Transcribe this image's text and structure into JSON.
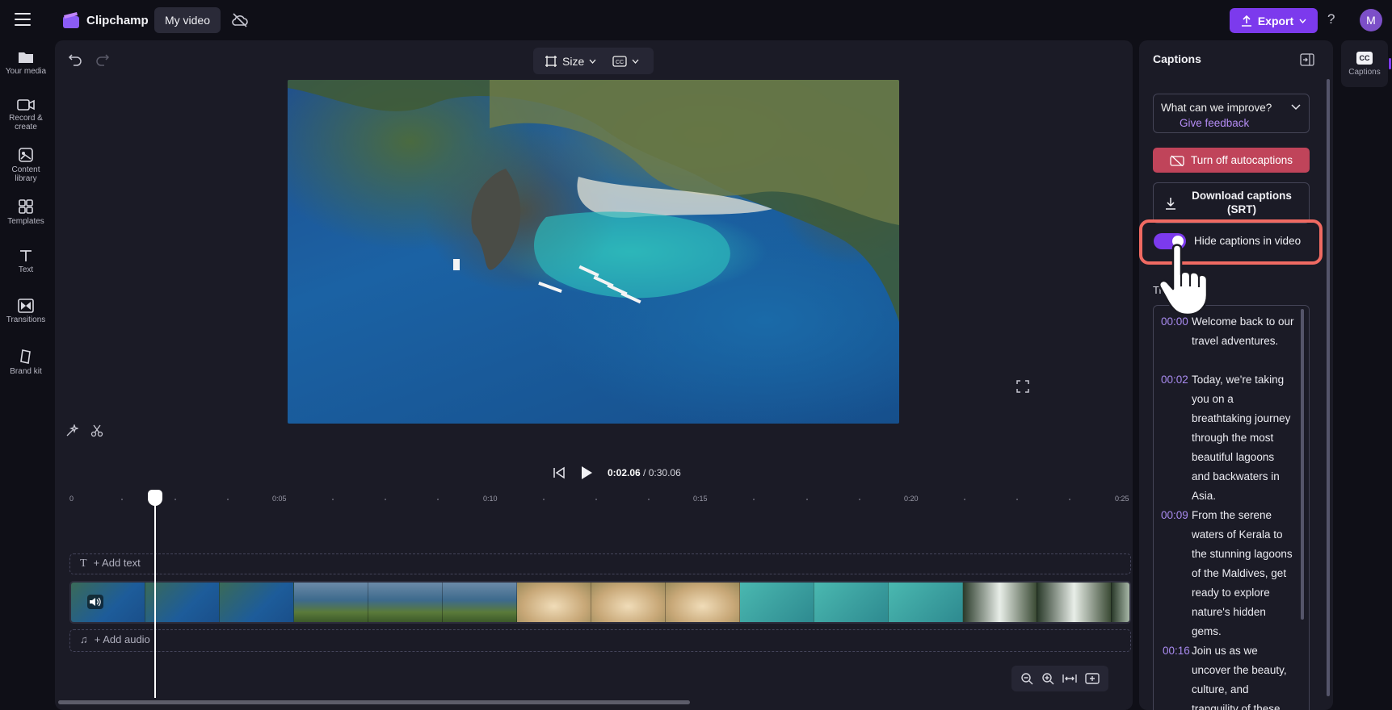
{
  "header": {
    "app_name": "Clipchamp",
    "project_name": "My video",
    "export_label": "Export",
    "help_label": "?",
    "avatar_initial": "M"
  },
  "sidebar": {
    "items": [
      {
        "label": "Your media",
        "icon": "folder-icon"
      },
      {
        "label": "Record & create",
        "icon": "record-icon"
      },
      {
        "label": "Content library",
        "icon": "library-icon"
      },
      {
        "label": "Templates",
        "icon": "templates-icon"
      },
      {
        "label": "Text",
        "icon": "text-icon"
      },
      {
        "label": "Transitions",
        "icon": "transitions-icon"
      },
      {
        "label": "Brand kit",
        "icon": "brand-kit-icon"
      }
    ]
  },
  "preview": {
    "size_label": "Size"
  },
  "timeline": {
    "current_time": "0:02.06",
    "total_time": "/ 0:30.06",
    "ruler": [
      "0",
      "0:05",
      "0:10",
      "0:15",
      "0:20",
      "0:25"
    ],
    "add_text_label": "+ Add text",
    "add_audio_label": "+ Add audio"
  },
  "captions_panel": {
    "title": "Captions",
    "feedback_question": "What can we improve?",
    "feedback_link": "Give feedback",
    "autocaptions_label": "Turn off autocaptions",
    "download_label": "Download captions (SRT)",
    "hide_toggle_label": "Hide captions in video",
    "hide_toggle_on": true,
    "transcript_label": "Tr",
    "transcript": [
      {
        "time": "00:00",
        "text": "Welcome back to our travel adventures."
      },
      {
        "time": "00:02",
        "text": "Today, we're taking you on a breathtaking journey through the most beautiful lagoons and backwaters in Asia."
      },
      {
        "time": "00:09",
        "text": "From the serene waters of Kerala to the stunning lagoons of the Maldives, get ready to explore nature's hidden gems."
      },
      {
        "time": "00:16",
        "text": "Join us as we uncover the beauty, culture, and tranquility of these"
      }
    ]
  },
  "right_rail": {
    "cc_badge": "CC",
    "label": "Captions"
  },
  "colors": {
    "accent": "#7c3aed",
    "danger": "#c0445a",
    "highlight": "#f06a62",
    "timestamp": "#a98bf0"
  }
}
